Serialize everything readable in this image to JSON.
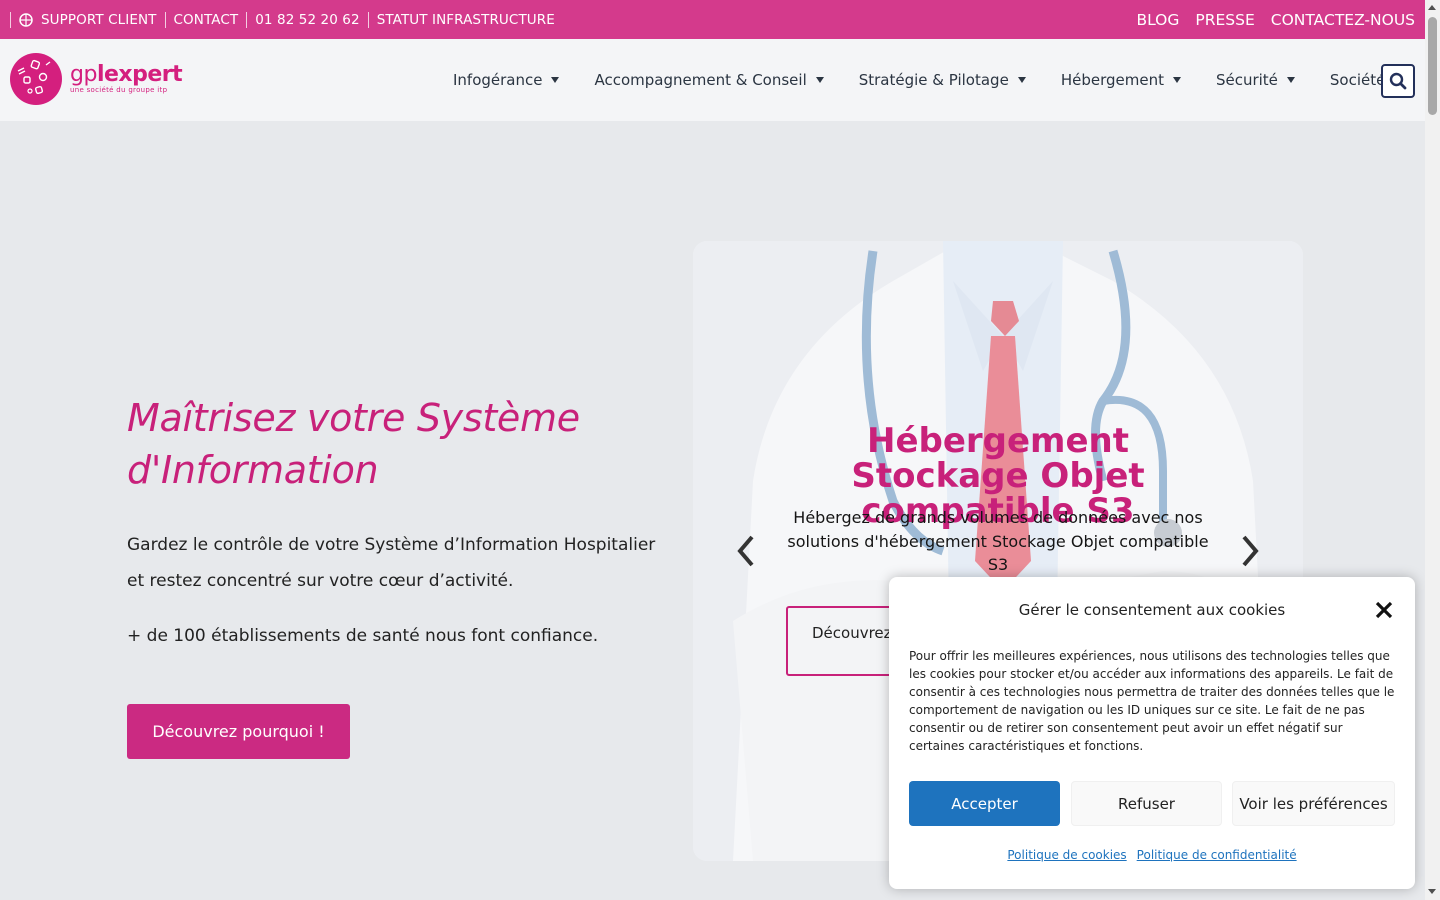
{
  "topbar": {
    "support_label": "SUPPORT CLIENT",
    "contact_label": "CONTACT",
    "phone": "01 82 52 20 62",
    "status_label": "STATUT INFRASTRUCTURE",
    "blog_label": "BLOG",
    "press_label": "PRESSE",
    "contact_us_label": "CONTACTEZ-NOUS",
    "globe_icon": "globe-icon"
  },
  "logo": {
    "word_light": "gp",
    "word_bold": "lexpert",
    "tagline": "une société du groupe itp"
  },
  "nav": {
    "items": [
      {
        "label": "Infogérance"
      },
      {
        "label": "Accompagnement & Conseil"
      },
      {
        "label": "Stratégie & Pilotage"
      },
      {
        "label": "Hébergement"
      },
      {
        "label": "Sécurité"
      },
      {
        "label": "Société"
      }
    ],
    "search_icon": "search-icon"
  },
  "hero": {
    "title": "Maîtrisez votre Système d'Information",
    "text": "Gardez le contrôle de votre Système d’Information Hospitalier et restez concentré sur votre cœur d’activité.",
    "text2": "+ de 100 établissements de santé nous font confiance.",
    "cta": "Découvrez pourquoi !"
  },
  "slider": {
    "title": "Hébergement Stockage Objet compatible S3",
    "subtitle": "Hébergez de grands volumes de données avec nos solutions d'hébergement Stockage Objet compatible S3",
    "button": "Découvrez"
  },
  "cookie": {
    "title": "Gérer le consentement aux cookies",
    "body": "Pour offrir les meilleures expériences, nous utilisons des technologies telles que les cookies pour stocker et/ou accéder aux informations des appareils. Le fait de consentir à ces technologies nous permettra de traiter des données telles que le comportement de navigation ou les ID uniques sur ce site. Le fait de ne pas consentir ou de retirer son consentement peut avoir un effet négatif sur certaines caractéristiques et fonctions.",
    "accept": "Accepter",
    "refuse": "Refuser",
    "preferences": "Voir les préférences",
    "cookie_policy": "Politique de cookies",
    "privacy_policy": "Politique de confidentialité"
  },
  "colors": {
    "brand_pink": "#d43a8c",
    "accent_blue": "#1e73be",
    "nav_text": "#2b3542"
  }
}
